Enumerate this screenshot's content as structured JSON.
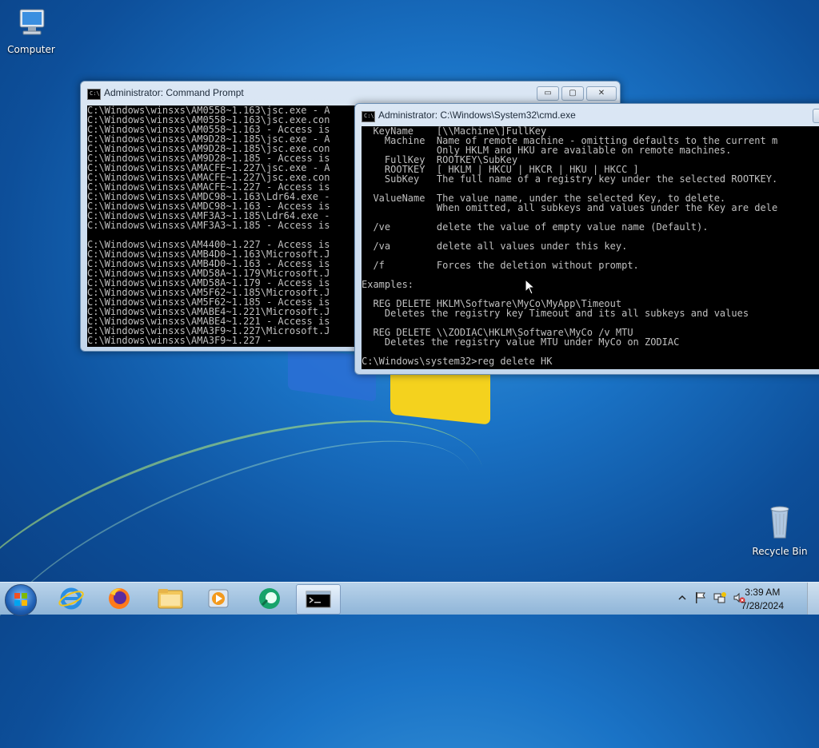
{
  "desktop": {
    "icons": [
      {
        "label": "Computer"
      },
      {
        "label": "Recycle Bin"
      }
    ]
  },
  "window_back": {
    "title": "Administrator:  Command Prompt",
    "lines": [
      "C:\\Windows\\winsxs\\AM0558~1.163\\jsc.exe - A",
      "C:\\Windows\\winsxs\\AM0558~1.163\\jsc.exe.con",
      "C:\\Windows\\winsxs\\AM0558~1.163 - Access is",
      "C:\\Windows\\winsxs\\AM9D28~1.185\\jsc.exe - A",
      "C:\\Windows\\winsxs\\AM9D28~1.185\\jsc.exe.con",
      "C:\\Windows\\winsxs\\AM9D28~1.185 - Access is",
      "C:\\Windows\\winsxs\\AMACFE~1.227\\jsc.exe - A",
      "C:\\Windows\\winsxs\\AMACFE~1.227\\jsc.exe.con",
      "C:\\Windows\\winsxs\\AMACFE~1.227 - Access is",
      "C:\\Windows\\winsxs\\AMDC98~1.163\\Ldr64.exe -",
      "C:\\Windows\\winsxs\\AMDC98~1.163 - Access is",
      "C:\\Windows\\winsxs\\AMF3A3~1.185\\Ldr64.exe -",
      "C:\\Windows\\winsxs\\AMF3A3~1.185 - Access is",
      "",
      "C:\\Windows\\winsxs\\AM4400~1.227 - Access is",
      "C:\\Windows\\winsxs\\AMB4D0~1.163\\Microsoft.J",
      "C:\\Windows\\winsxs\\AMB4D0~1.163 - Access is",
      "C:\\Windows\\winsxs\\AMD58A~1.179\\Microsoft.J",
      "C:\\Windows\\winsxs\\AMD58A~1.179 - Access is",
      "C:\\Windows\\winsxs\\AM5F62~1.185\\Microsoft.J",
      "C:\\Windows\\winsxs\\AM5F62~1.185 - Access is",
      "C:\\Windows\\winsxs\\AMABE4~1.221\\Microsoft.J",
      "C:\\Windows\\winsxs\\AMABE4~1.221 - Access is",
      "C:\\Windows\\winsxs\\AMA3F9~1.227\\Microsoft.J",
      "C:\\Windows\\winsxs\\AMA3F9~1.227 -"
    ],
    "controls": {
      "minimize": "▭",
      "maximize": "▢",
      "close": "✕"
    }
  },
  "window_front": {
    "title": "Administrator: C:\\Windows\\System32\\cmd.exe",
    "lines": [
      "  KeyName    [\\\\Machine\\]FullKey",
      "    Machine  Name of remote machine - omitting defaults to the current m",
      "             Only HKLM and HKU are available on remote machines.",
      "    FullKey  ROOTKEY\\SubKey",
      "    ROOTKEY  [ HKLM | HKCU | HKCR | HKU | HKCC ]",
      "    SubKey   The full name of a registry key under the selected ROOTKEY.",
      "",
      "  ValueName  The value name, under the selected Key, to delete.",
      "             When omitted, all subkeys and values under the Key are dele",
      "",
      "  /ve        delete the value of empty value name (Default).",
      "",
      "  /va        delete all values under this key.",
      "",
      "  /f         Forces the deletion without prompt.",
      "",
      "Examples:",
      "",
      "  REG DELETE HKLM\\Software\\MyCo\\MyApp\\Timeout",
      "    Deletes the registry key Timeout and its all subkeys and values",
      "",
      "  REG DELETE \\\\ZODIAC\\HKLM\\Software\\MyCo /v MTU",
      "    Deletes the registry value MTU under MyCo on ZODIAC",
      "",
      "C:\\Windows\\system32>reg delete HK"
    ]
  },
  "taskbar": {
    "pinned": [
      "internet-explorer",
      "firefox",
      "file-explorer",
      "media-player",
      "app-green",
      "command-prompt"
    ],
    "clock": {
      "time": "3:39 AM",
      "date": "7/28/2024"
    },
    "tray_icons": [
      "show-hidden-icons-arrow",
      "action-center-flag",
      "network-icon",
      "volume-muted-icon"
    ]
  }
}
